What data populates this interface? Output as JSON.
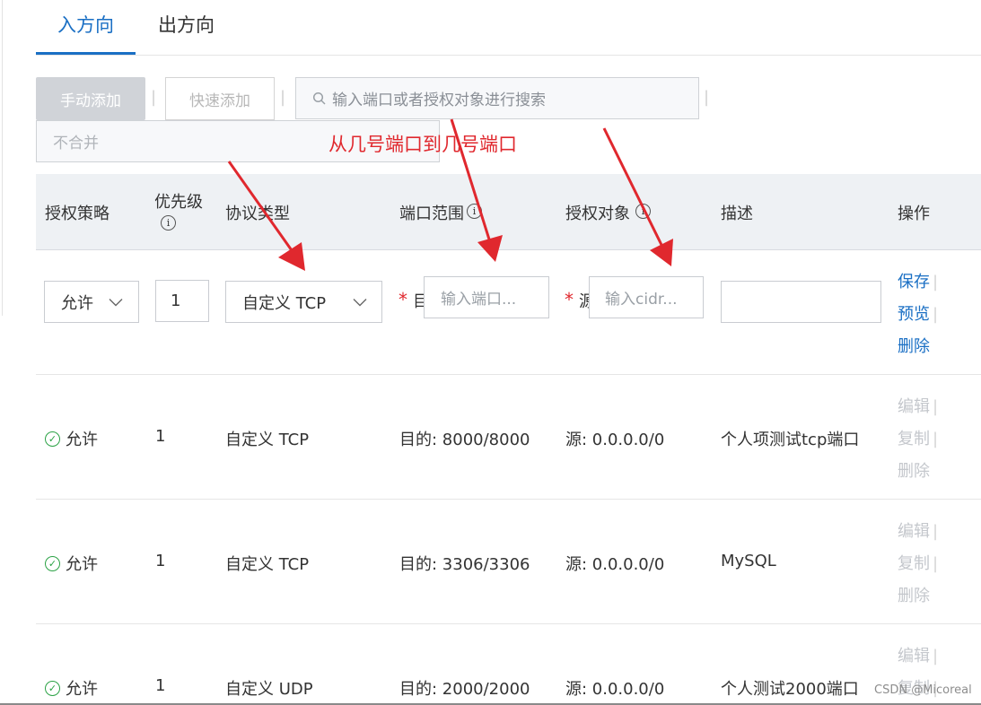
{
  "tabs": [
    {
      "label": "入方向",
      "active": true
    },
    {
      "label": "出方向",
      "active": false
    }
  ],
  "toolbar": {
    "manual_add": "手动添加",
    "quick_add": "快速添加",
    "separator": "|",
    "search_placeholder": "输入端口或者授权对象进行搜索",
    "merge_option": "不合并"
  },
  "annotation": "从几号端口到几号端口",
  "columns": {
    "policy": "授权策略",
    "priority": "优先级",
    "protocol": "协议类型",
    "port_range": "端口范围",
    "auth_object": "授权对象",
    "description": "描述",
    "actions": "操作"
  },
  "edit_row": {
    "policy": "允许",
    "priority": "1",
    "protocol": "自定义 TCP",
    "port_label_clipped": "目",
    "port_placeholder": "输入端口...",
    "source_label_clipped": "源",
    "cidr_placeholder": "输入cidr...",
    "description": "",
    "actions": {
      "save": "保存",
      "preview": "预览",
      "delete": "删除"
    }
  },
  "rows": [
    {
      "policy": "允许",
      "priority": "1",
      "protocol": "自定义 TCP",
      "port": "目的: 8000/8000",
      "source": "源: 0.0.0.0/0",
      "description": "个人项测试tcp端口"
    },
    {
      "policy": "允许",
      "priority": "1",
      "protocol": "自定义 TCP",
      "port": "目的: 3306/3306",
      "source": "源: 0.0.0.0/0",
      "description": "MySQL"
    },
    {
      "policy": "允许",
      "priority": "1",
      "protocol": "自定义 UDP",
      "port": "目的: 2000/2000",
      "source": "源: 0.0.0.0/0",
      "description": "个人测试2000端口"
    }
  ],
  "row_actions": {
    "edit": "编辑",
    "copy": "复制",
    "delete": "删除"
  },
  "watermark": "CSDN @Micoreal",
  "colors": {
    "accent": "#1a6fc4",
    "annotation_red": "#e0282e",
    "allow_green": "#2ba245"
  }
}
